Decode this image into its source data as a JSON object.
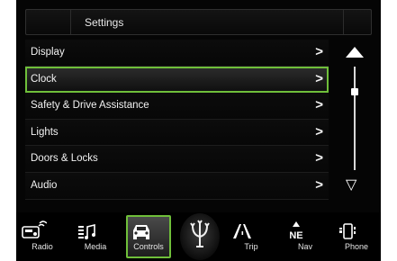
{
  "header": {
    "title": "Settings"
  },
  "menu": {
    "items": [
      {
        "label": "Display",
        "chevron": ">"
      },
      {
        "label": "Clock",
        "chevron": ">",
        "selected": true
      },
      {
        "label": "Safety & Drive Assistance",
        "chevron": ">"
      },
      {
        "label": "Lights",
        "chevron": ">"
      },
      {
        "label": "Doors & Locks",
        "chevron": ">"
      },
      {
        "label": "Audio",
        "chevron": ">"
      }
    ]
  },
  "scrollbar": {
    "up_icon": "triangle-up-icon",
    "down_icon": "triangle-down-icon",
    "down_glyph": "▽"
  },
  "tabs": [
    {
      "label": "Radio",
      "icon": "radio-icon"
    },
    {
      "label": "Media",
      "icon": "media-icon"
    },
    {
      "label": "Controls",
      "icon": "car-icon",
      "active": true
    },
    {
      "label": "Trip",
      "icon": "road-icon"
    },
    {
      "label": "Nav",
      "icon": "compass-icon",
      "compass": "NE"
    },
    {
      "label": "Phone",
      "icon": "phone-icon"
    }
  ],
  "colors": {
    "accent": "#6fbf3a",
    "background": "#050505",
    "text": "#ffffff"
  }
}
